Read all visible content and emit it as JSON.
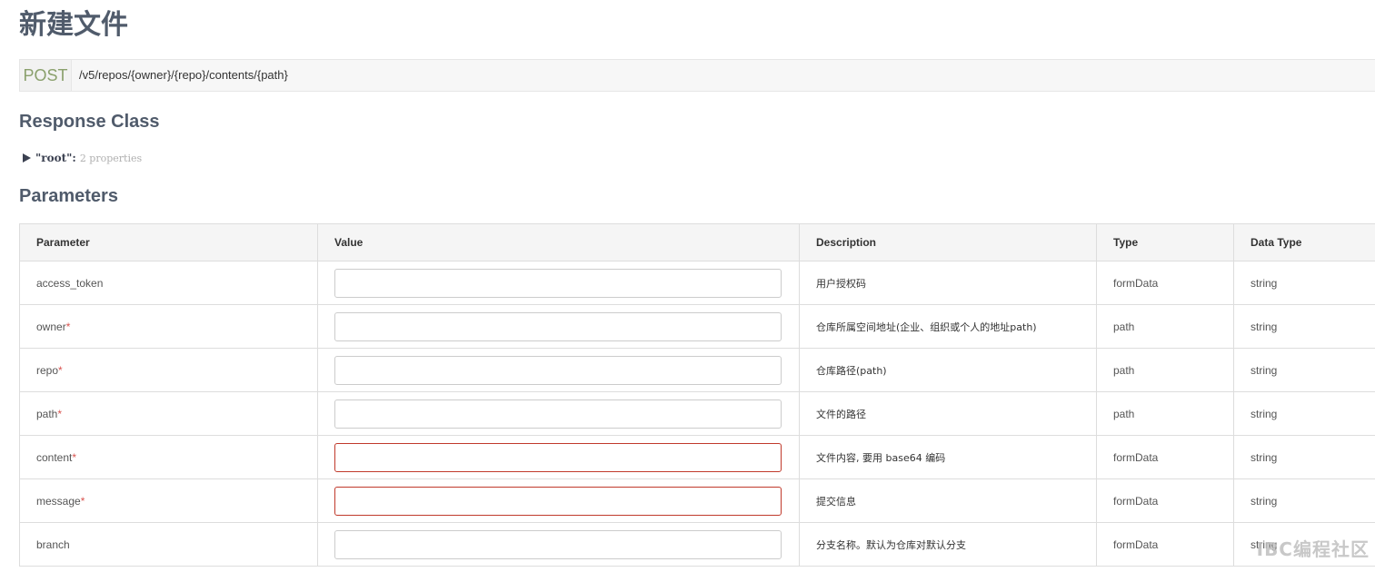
{
  "page": {
    "title": "新建文件"
  },
  "endpoint": {
    "method": "POST",
    "path": "/v5/repos/{owner}/{repo}/contents/{path}"
  },
  "response_class": {
    "title": "Response Class",
    "root_name": "\"root\":",
    "root_props": "2 properties"
  },
  "parameters": {
    "title": "Parameters",
    "headers": [
      "Parameter",
      "Value",
      "Description",
      "Type",
      "Data Type"
    ],
    "rows": [
      {
        "name": "access_token",
        "required": "",
        "value": "",
        "description": "用户授权码",
        "type": "formData",
        "data_type": "string",
        "error": false
      },
      {
        "name": "owner",
        "required": "*",
        "value": "",
        "description": "仓库所属空间地址(企业、组织或个人的地址path)",
        "type": "path",
        "data_type": "string",
        "error": false
      },
      {
        "name": "repo",
        "required": "*",
        "value": "",
        "description": "仓库路径(path)",
        "type": "path",
        "data_type": "string",
        "error": false
      },
      {
        "name": "path",
        "required": "*",
        "value": "",
        "description": "文件的路径",
        "type": "path",
        "data_type": "string",
        "error": false
      },
      {
        "name": "content",
        "required": "*",
        "value": "",
        "description": "文件内容, 要用 base64 编码",
        "type": "formData",
        "data_type": "string",
        "error": true
      },
      {
        "name": "message",
        "required": "*",
        "value": "",
        "description": "提交信息",
        "type": "formData",
        "data_type": "string",
        "error": true
      },
      {
        "name": "branch",
        "required": "",
        "value": "",
        "description": "分支名称。默认为仓库对默认分支",
        "type": "formData",
        "data_type": "string",
        "error": false
      }
    ]
  },
  "watermark": {
    "text": "IBC编程社区"
  },
  "colors": {
    "method_green": "#8aa06c",
    "heading": "#505b6b",
    "required": "#d9534f",
    "error_border": "#c0392b"
  }
}
